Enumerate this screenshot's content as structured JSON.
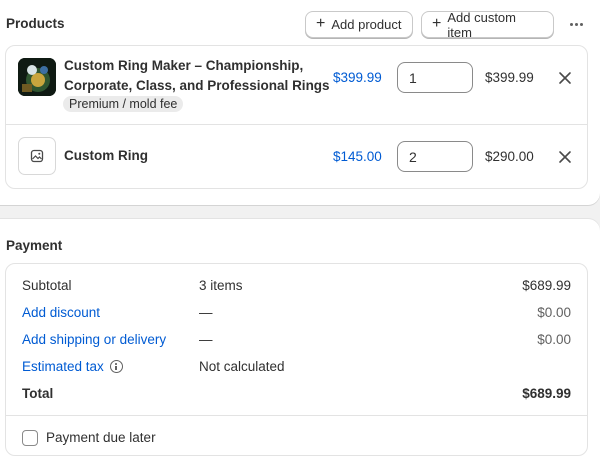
{
  "products": {
    "title": "Products",
    "add_product_label": "Add product",
    "add_custom_item_label": "Add custom item",
    "items": [
      {
        "title_line1": "Custom Ring Maker – Championship,",
        "title_line2": "Corporate, Class, and Professional Rings",
        "variant": "Premium / mold fee",
        "unit_price": "$399.99",
        "quantity": "1",
        "line_total": "$399.99",
        "thumbnail": "product-photo"
      },
      {
        "title_line1": "Custom Ring",
        "unit_price": "$145.00",
        "quantity": "2",
        "line_total": "$290.00",
        "thumbnail": "image-placeholder-icon"
      }
    ]
  },
  "payment": {
    "title": "Payment",
    "subtotal": {
      "label": "Subtotal",
      "detail": "3 items",
      "amount": "$689.99"
    },
    "discount": {
      "label": "Add discount",
      "detail": "—",
      "amount": "$0.00"
    },
    "shipping": {
      "label": "Add shipping or delivery",
      "detail": "—",
      "amount": "$0.00"
    },
    "tax": {
      "label": "Estimated tax",
      "detail": "Not calculated"
    },
    "total": {
      "label": "Total",
      "amount": "$689.99"
    },
    "due_later": {
      "label": "Payment due later",
      "checked": false
    }
  },
  "colors": {
    "link": "#005bd3",
    "text": "#303030",
    "muted": "#616161",
    "background": "#f1f1f1"
  }
}
